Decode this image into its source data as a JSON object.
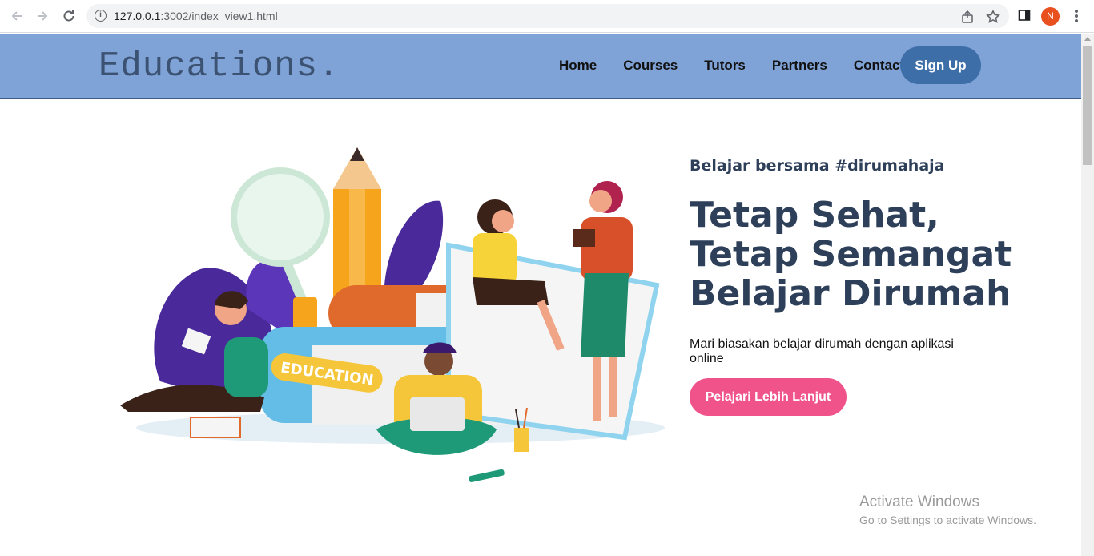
{
  "browser": {
    "url_host": "127.0.0.1",
    "url_rest": ":3002/index_view1.html",
    "profile_initial": "N"
  },
  "site": {
    "logo": "Educations.",
    "menu": [
      "Home",
      "Courses",
      "Tutors",
      "Partners",
      "Contact"
    ],
    "signup_label": "Sign Up"
  },
  "hero": {
    "eyebrow": "Belajar bersama #dirumahaja",
    "headline": [
      "Tetap Sehat,",
      "Tetap Semangat",
      "Belajar Dirumah"
    ],
    "description": "Mari biasakan belajar dirumah dengan aplikasi online",
    "cta_label": "Pelajari Lebih Lanjut",
    "book_label": "EDUCATION"
  },
  "watermark": {
    "title": "Activate Windows",
    "subtitle": "Go to Settings to activate Windows."
  },
  "colors": {
    "header_bg": "#7fa3d6",
    "signup_bg": "#3e6ea8",
    "cta_bg": "#f0528a",
    "headline": "#2d3f59"
  }
}
